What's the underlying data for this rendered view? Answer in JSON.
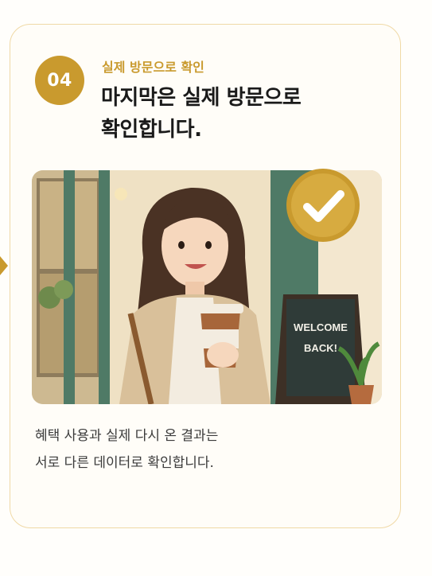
{
  "step": {
    "number": "04",
    "eyebrow": "실제 방문으로 확인",
    "headline_line1": "마지막은 실제 방문으로",
    "headline_line2": "확인합니다."
  },
  "hero_image": {
    "sign_line1": "WELCOME",
    "sign_line2": "BACK!",
    "badge_icon": "check-icon"
  },
  "description": {
    "line1": "혜택 사용과 실제 다시 온 결과는",
    "line2": "서로 다른 데이터로 확인합니다."
  },
  "colors": {
    "accent": "#c99a2e",
    "border": "#f0d9a6",
    "text": "#1a1a1a"
  }
}
